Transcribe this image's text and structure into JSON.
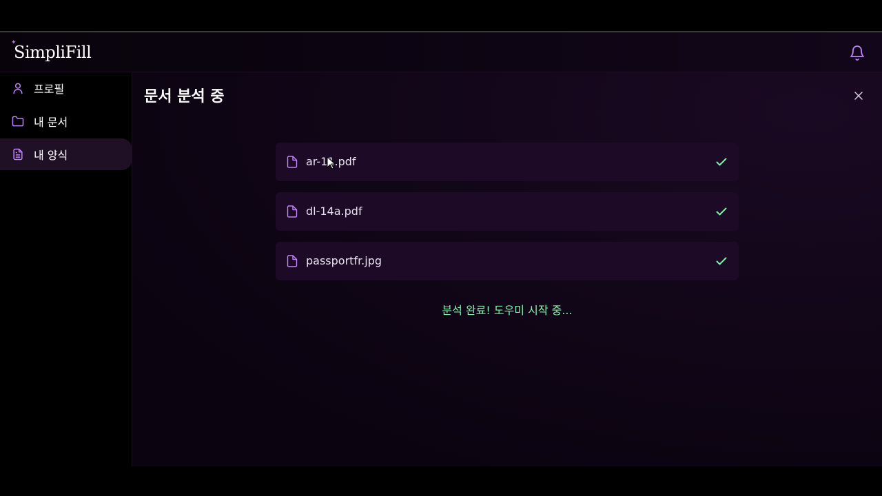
{
  "app": {
    "logo": "SimpliFill",
    "accent_color": "#c084fc",
    "success_color": "#86efac"
  },
  "sidebar": {
    "items": [
      {
        "label": "프로필",
        "icon": "user-icon",
        "active": false
      },
      {
        "label": "내 문서",
        "icon": "folder-icon",
        "active": false
      },
      {
        "label": "내 양식",
        "icon": "file-text-icon",
        "active": true
      }
    ]
  },
  "main": {
    "title": "문서 분석 중",
    "files": [
      {
        "name": "ar-11.pdf",
        "status": "done"
      },
      {
        "name": "dl-14a.pdf",
        "status": "done"
      },
      {
        "name": "passportfr.jpg",
        "status": "done"
      }
    ],
    "status_text": "분석 완료! 도우미 시작 중..."
  }
}
